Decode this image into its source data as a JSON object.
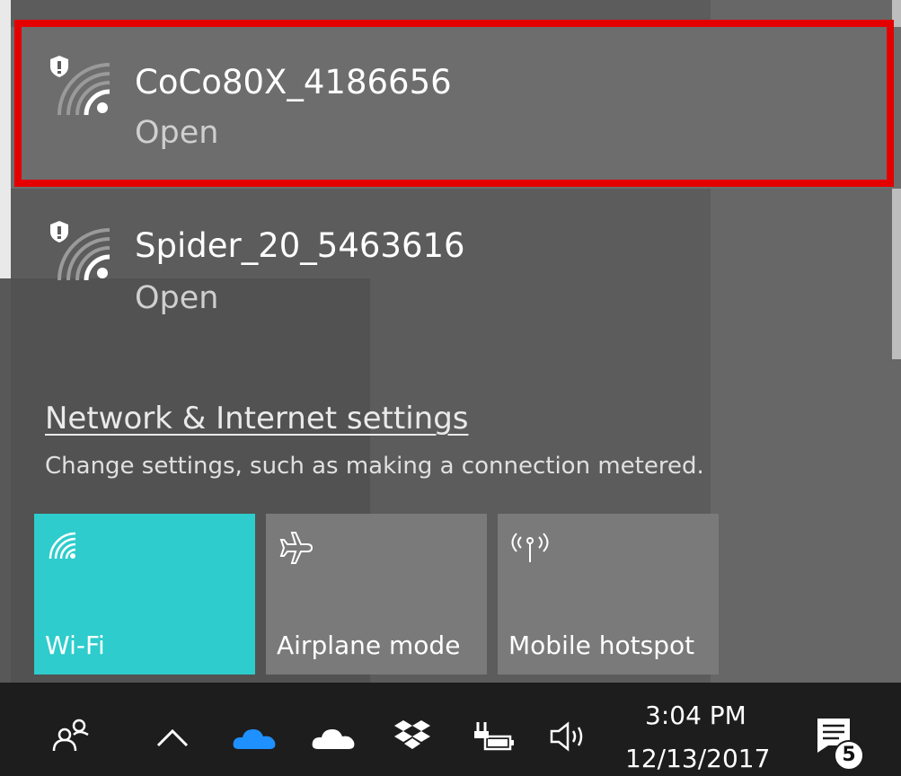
{
  "network_list": {
    "items": [
      {
        "ssid": "CoCo80X_4186656",
        "status": "Open",
        "icon": "wifi-signal-secured-icon",
        "selected": true
      },
      {
        "ssid": "Spider_20_5463616",
        "status": "Open",
        "icon": "wifi-signal-secured-icon",
        "selected": false
      }
    ]
  },
  "settings": {
    "link_label": "Network & Internet settings",
    "description": "Change settings, such as making a connection metered."
  },
  "quick_actions": [
    {
      "label": "Wi-Fi",
      "icon": "wifi-icon",
      "active": true
    },
    {
      "label": "Airplane mode",
      "icon": "airplane-icon",
      "active": false
    },
    {
      "label": "Mobile hotspot",
      "icon": "mobile-hotspot-icon",
      "active": false
    }
  ],
  "taskbar": {
    "time": "3:04 PM",
    "date": "12/13/2017",
    "notification_count": "5",
    "tray_icons": [
      "people-icon",
      "show-hidden-icons-chevron-icon",
      "onedrive-icon",
      "onedrive-personal-icon",
      "dropbox-icon",
      "battery-charging-icon",
      "volume-icon",
      "action-center-icon"
    ]
  },
  "colors": {
    "flyout_background": "#5c5c5c",
    "selected_item": "#6d6d6d",
    "highlight_frame": "#e50000",
    "active_tile": "#2ecccc",
    "inactive_tile": "#7a7a7a",
    "taskbar": "#1d1d1d"
  }
}
